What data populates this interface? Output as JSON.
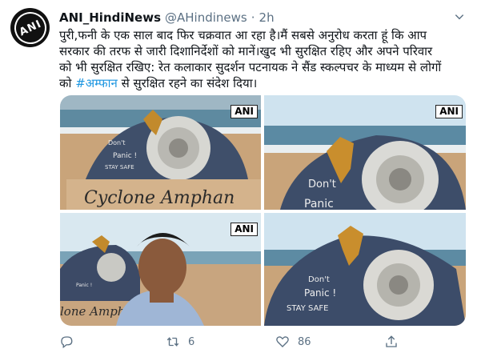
{
  "author": {
    "display_name": "ANI_HindiNews",
    "handle": "@AHindinews",
    "separator": "·",
    "time": "2h",
    "avatar_text": "ANI"
  },
  "tweet": {
    "line1": "पुरी,फनी के एक साल बाद फिर चक्रवात आ रहा है।मैं सबसे अनुरोध करता हूं कि आप",
    "line2": "सरकार की तरफ से जारी दिशानिर्देशों को मानें।खुद भी सुरक्षित रहिए और अपने परिवार",
    "line3": "को भी सुरक्षित रखिए: रेत कलाकार सुदर्शन पटनायक ने सैंड स्कल्पचर के माध्यम से लोगों",
    "line4_prefix": "को ",
    "hashtag": "#अम्फान",
    "line4_suffix": " से सुरक्षित रहने का संदेश दिया।"
  },
  "media": {
    "watermark": "ANI",
    "sculpture_text_1": "Don't",
    "sculpture_text_2": "Panic !",
    "sculpture_text_3": "STAY SAFE",
    "banner_text": "Cyclone Amphan",
    "banner_text_partial": "lone Amphan",
    "c2_text_1": "Don't",
    "c2_text_2": "Panic"
  },
  "actions": {
    "reply_count": "",
    "retweet_count": "6",
    "like_count": "86"
  },
  "colors": {
    "link": "#1b95e0",
    "muted": "#5b7083",
    "sky": "#cfe3ef",
    "sea": "#4f7f97",
    "sand": "#c9a47a"
  }
}
